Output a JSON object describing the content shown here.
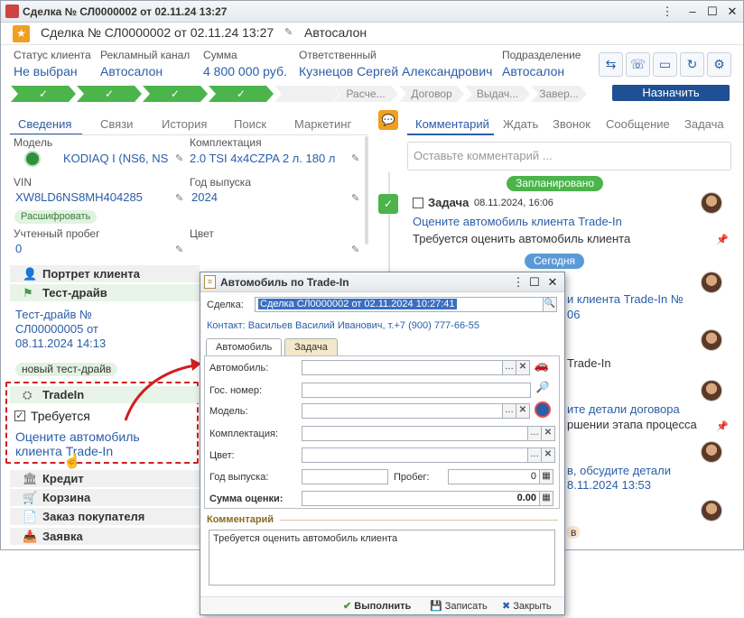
{
  "window": {
    "title": "Сделка № СЛ0000002 от 02.11.24 13:27"
  },
  "header": {
    "title": "Сделка № СЛ0000002 от 02.11.24 13:27",
    "subtitle": "Автосалон"
  },
  "fields": {
    "status_label": "Статус клиента",
    "status_value": "Не выбран",
    "channel_label": "Рекламный канал",
    "channel_value": "Автосалон",
    "sum_label": "Сумма",
    "sum_value": "4 800 000 руб.",
    "resp_label": "Ответственный",
    "resp_value": "Кузнецов Сергей Александрович",
    "dept_label": "Подразделение",
    "dept_value": "Автосалон"
  },
  "stages": [
    "Расче...",
    "Договор",
    "Выдач...",
    "Завер..."
  ],
  "assign_label": "Назначить",
  "left_tabs": [
    "Сведения",
    "Связи",
    "История",
    "Поиск",
    "Маркетинг"
  ],
  "car": {
    "model_label": "Модель",
    "model_value": "KODIAQ I (NS6, NS",
    "compl_label": "Комплектация",
    "compl_value": "2.0 TSI 4x4CZPA 2 л. 180 л",
    "vin_label": "VIN",
    "vin_value": "XW8LD6NS8MH404285",
    "year_label": "Год выпуска",
    "year_value": "2024",
    "decode_label": "Расшифровать",
    "mileage_label": "Учтенный пробег",
    "mileage_value": "0",
    "color_label": "Цвет"
  },
  "sections": {
    "portrait": "Портрет клиента",
    "testdrive": "Тест-драйв",
    "testdrive_link": "Тест-драйв № СЛ00000005 от 08.11.2024 14:13",
    "new_testdrive": "новый тест-драйв",
    "tradein": "TradeIn",
    "required": "Требуется",
    "tradein_link": "Оцените автомобиль клиента Trade-In",
    "credit": "Кредит",
    "cart": "Корзина",
    "order": "Заказ покупателя",
    "request": "Заявка"
  },
  "right_tabs": [
    "Комментарий",
    "Ждать",
    "Звонок",
    "Сообщение",
    "Задача"
  ],
  "comment_placeholder": "Оставьте комментарий ...",
  "timeline": {
    "planned": "Запланировано",
    "task_title": "Задача",
    "task_date": "08.11.2024, 16:06",
    "task_link": "Оцените автомобиль клиента Trade-In",
    "task_desc": "Требуется оценить автомобиль клиента",
    "today": "Сегодня",
    "item1": "и клиента Trade-In №",
    "item1b": "06",
    "item2": "Trade-In",
    "item3": "ите детали договора",
    "item3b": "ршении этапа процесса",
    "item4": "в, обсудите детали",
    "item4b": "8.11.2024 13:53",
    "item5": "в"
  },
  "dialog": {
    "title": "Автомобиль по Trade-In",
    "deal_label": "Сделка:",
    "deal_value": "Сделка СЛ0000002 от 02.11.2024 10:27:41",
    "contact": "Контакт: Васильев Василий Иванович, т.+7 (900) 777-66-55",
    "tab_car": "Автомобиль",
    "tab_task": "Задача",
    "car_label": "Автомобиль:",
    "plate_label": "Гос. номер:",
    "model_label": "Модель:",
    "compl_label": "Комплектация:",
    "color_label": "Цвет:",
    "year_label": "Год выпуска:",
    "mileage_label": "Пробег:",
    "mileage_value": "0",
    "sum_label": "Сумма оценки:",
    "sum_value": "0.00",
    "comment_header": "Комментарий",
    "comment_text": "Требуется оценить автомобиль клиента",
    "btn_execute": "Выполнить",
    "btn_save": "Записать",
    "btn_close": "Закрыть"
  }
}
